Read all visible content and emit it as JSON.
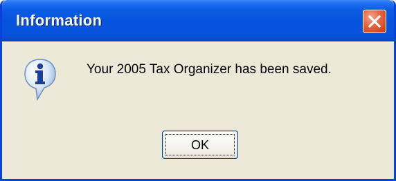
{
  "window": {
    "title": "Information"
  },
  "dialog": {
    "icon": "information-icon",
    "message": "Your 2005 Tax Organizer has been saved.",
    "ok_label": "OK"
  },
  "colors": {
    "titlebar": "#0654de",
    "window_border": "#0842d6",
    "body_background": "#ece9d8",
    "close_button": "#e6633d"
  }
}
